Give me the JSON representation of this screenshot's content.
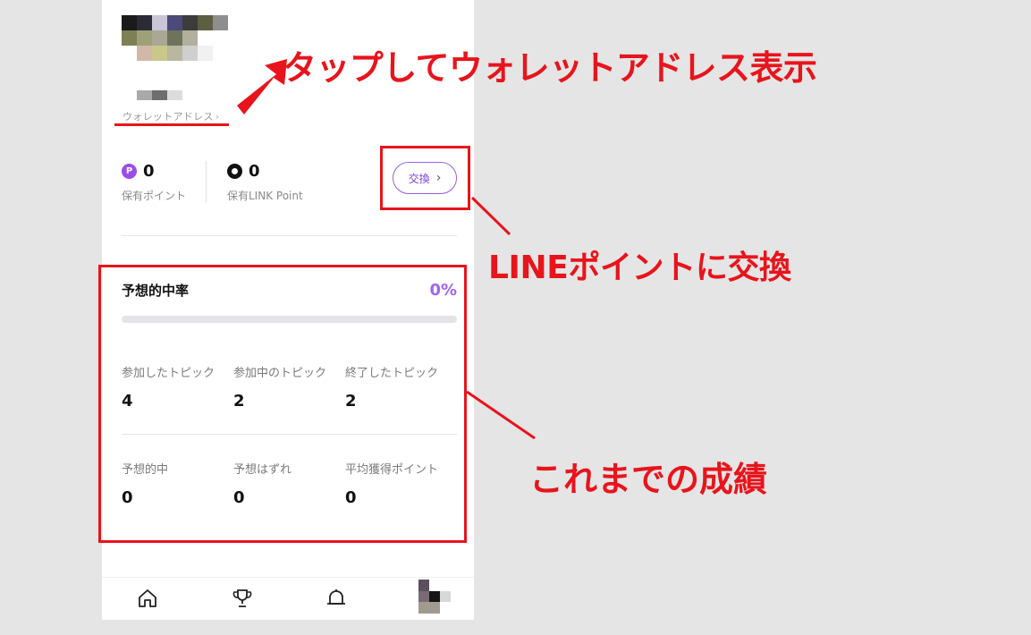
{
  "wallet": {
    "label": "ウォレットアドレス",
    "chevron": "›"
  },
  "points": {
    "owned": {
      "value": "0",
      "label": "保有ポイント",
      "icon_text": "P"
    },
    "link": {
      "value": "0",
      "label": "保有LINK Point"
    }
  },
  "exchange_button": {
    "label": "交換",
    "chevron": "›"
  },
  "prediction": {
    "title": "予想的中率",
    "rate": "0%",
    "progress_fraction": 0,
    "stats": [
      {
        "label": "参加したトピック",
        "value": "4"
      },
      {
        "label": "参加中のトピック",
        "value": "2"
      },
      {
        "label": "終了したトピック",
        "value": "2"
      },
      {
        "label": "予想的中",
        "value": "0"
      },
      {
        "label": "予想はずれ",
        "value": "0"
      },
      {
        "label": "平均獲得ポイント",
        "value": "0"
      }
    ]
  },
  "nav": {
    "items": [
      {
        "name": "home",
        "icon": "home-icon"
      },
      {
        "name": "trophy",
        "icon": "trophy-icon"
      },
      {
        "name": "notifications",
        "icon": "bell-icon"
      },
      {
        "name": "profile",
        "icon": "avatar"
      }
    ]
  },
  "annotations": {
    "wallet_tip": "タップしてウォレットアドレス表示",
    "exchange_tip": "LINEポイントに交換",
    "record_tip": "これまでの成績"
  },
  "colors": {
    "accent": "#9b5de5",
    "highlight": "#e8141c",
    "rate": "#a065ef"
  }
}
